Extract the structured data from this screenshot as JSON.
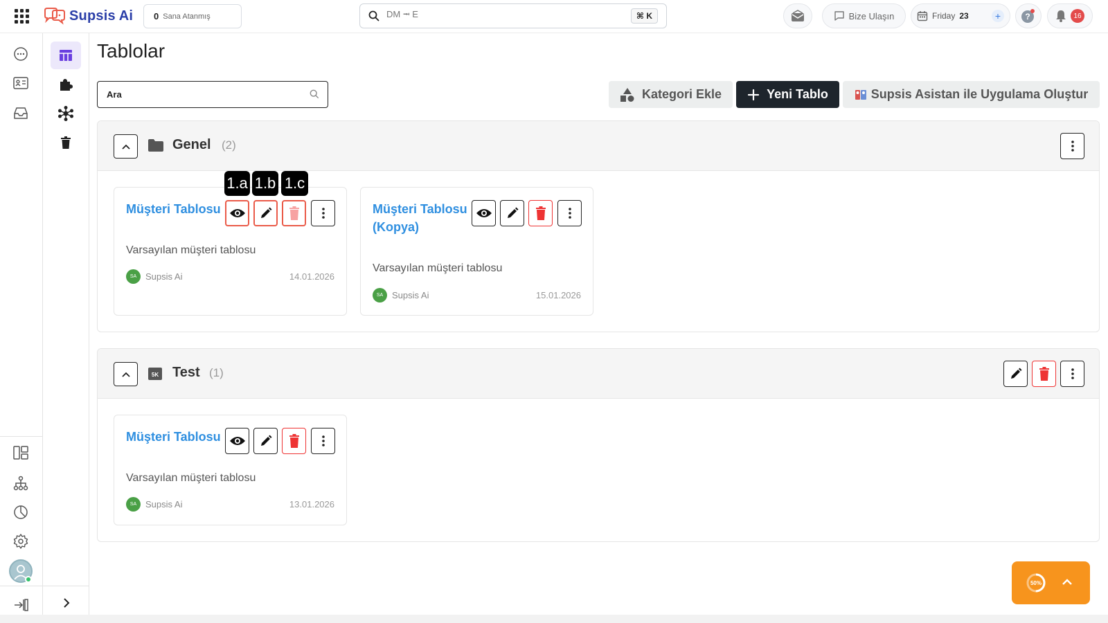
{
  "app": {
    "name": "Supsis Ai"
  },
  "topbar": {
    "assigned_count": "0",
    "assigned_label": "Sana Atanmış",
    "search_placeholder": "DM ⭲ E",
    "search_shortcut": "⌘ K",
    "contact_label": "Bize Ulaşın",
    "date_day": "Friday",
    "date_num": "23",
    "notifications_count": "16"
  },
  "page": {
    "title": "Tablolar",
    "search_placeholder": "Ara",
    "buttons": {
      "add_category": "Kategori Ekle",
      "new_table": "Yeni Tablo",
      "assistant": "Supsis Asistan ile Uygulama Oluştur"
    }
  },
  "sections": [
    {
      "title": "Genel",
      "count": "(2)",
      "cards": [
        {
          "title": "Müşteri Tablosu",
          "description": "Varsayılan müşteri tablosu",
          "author_initials": "SA",
          "author": "Supsis Ai",
          "date": "14.01.2026"
        },
        {
          "title": "Müşteri Tablosu (Kopya)",
          "description": "Varsayılan müşteri tablosu",
          "author_initials": "SA",
          "author": "Supsis Ai",
          "date": "15.01.2026"
        }
      ]
    },
    {
      "title": "Test",
      "icon_text": "5K",
      "count": "(1)",
      "cards": [
        {
          "title": "Müşteri Tablosu",
          "description": "Varsayılan müşteri tablosu",
          "author_initials": "SA",
          "author": "Supsis Ai",
          "date": "13.01.2026"
        }
      ]
    }
  ],
  "annotations": [
    "1.a",
    "1.b",
    "1.c"
  ],
  "progress": {
    "percent": 50,
    "label": "50%"
  },
  "colors": {
    "accent": "#2f8fe0",
    "danger": "#e33333",
    "progress": "#f7941d",
    "dark": "#1e252c"
  }
}
